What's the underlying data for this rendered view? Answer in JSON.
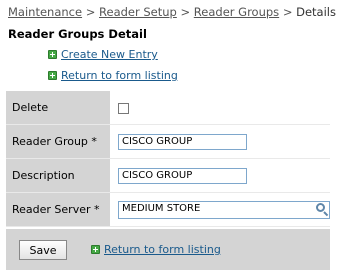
{
  "breadcrumb": {
    "items": [
      "Maintenance",
      "Reader Setup",
      "Reader Groups"
    ],
    "separator": ">",
    "current": "Details"
  },
  "page_title": "Reader Groups Detail",
  "links": {
    "create_new": "Create New Entry",
    "return_listing": "Return to form listing"
  },
  "form": {
    "delete": {
      "label": "Delete",
      "checked": false
    },
    "reader_group": {
      "label": "Reader Group *",
      "value": "CISCO GROUP"
    },
    "description": {
      "label": "Description",
      "value": "CISCO GROUP"
    },
    "reader_server": {
      "label": "Reader Server *",
      "value": "MEDIUM STORE",
      "icon": "magnifier-icon"
    }
  },
  "footer": {
    "save_label": "Save",
    "return_listing": "Return to form listing"
  },
  "colors": {
    "link": "#1a5a8c",
    "label_bg": "#d4d4d4",
    "input_border": "#7ea7cc",
    "add_icon": "#44a844"
  }
}
